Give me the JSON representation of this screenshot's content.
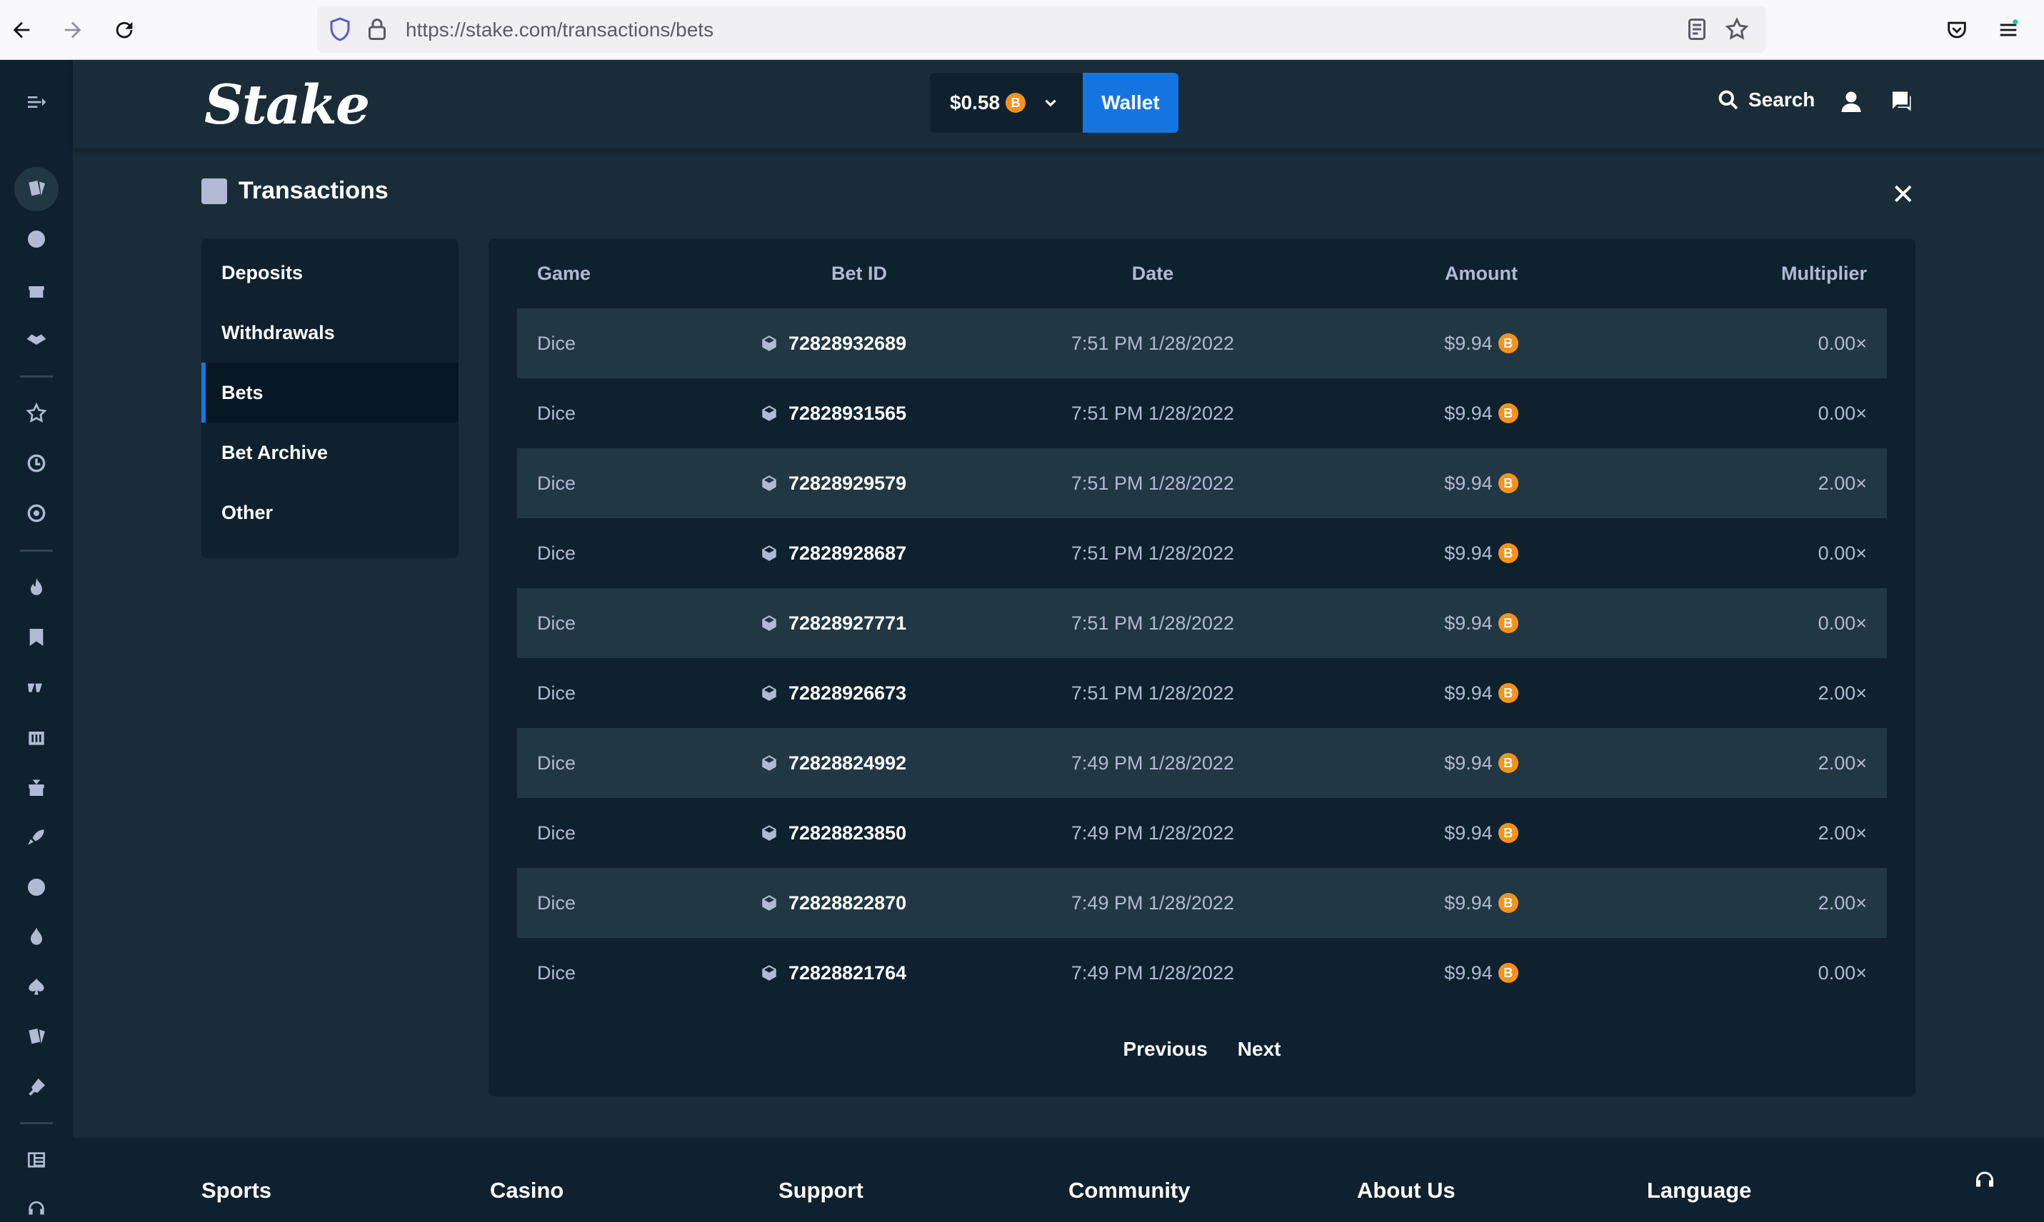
{
  "browser": {
    "url": "https://stake.com/transactions/bets"
  },
  "header": {
    "logo": "Stake",
    "balance": "$0.58",
    "coin_symbol": "B",
    "wallet_label": "Wallet",
    "search_label": "Search"
  },
  "page": {
    "title": "Transactions",
    "close_label": "✕"
  },
  "menu": {
    "items": [
      "Deposits",
      "Withdrawals",
      "Bets",
      "Bet Archive",
      "Other"
    ],
    "active": "Bets"
  },
  "table": {
    "headers": {
      "game": "Game",
      "bet_id": "Bet ID",
      "date": "Date",
      "amount": "Amount",
      "multiplier": "Multiplier"
    },
    "rows": [
      {
        "game": "Dice",
        "bet_id": "72828932689",
        "date": "7:51 PM 1/28/2022",
        "amount": "$9.94",
        "multiplier": "0.00×"
      },
      {
        "game": "Dice",
        "bet_id": "72828931565",
        "date": "7:51 PM 1/28/2022",
        "amount": "$9.94",
        "multiplier": "0.00×"
      },
      {
        "game": "Dice",
        "bet_id": "72828929579",
        "date": "7:51 PM 1/28/2022",
        "amount": "$9.94",
        "multiplier": "2.00×"
      },
      {
        "game": "Dice",
        "bet_id": "72828928687",
        "date": "7:51 PM 1/28/2022",
        "amount": "$9.94",
        "multiplier": "0.00×"
      },
      {
        "game": "Dice",
        "bet_id": "72828927771",
        "date": "7:51 PM 1/28/2022",
        "amount": "$9.94",
        "multiplier": "0.00×"
      },
      {
        "game": "Dice",
        "bet_id": "72828926673",
        "date": "7:51 PM 1/28/2022",
        "amount": "$9.94",
        "multiplier": "2.00×"
      },
      {
        "game": "Dice",
        "bet_id": "72828824992",
        "date": "7:49 PM 1/28/2022",
        "amount": "$9.94",
        "multiplier": "2.00×"
      },
      {
        "game": "Dice",
        "bet_id": "72828823850",
        "date": "7:49 PM 1/28/2022",
        "amount": "$9.94",
        "multiplier": "2.00×"
      },
      {
        "game": "Dice",
        "bet_id": "72828822870",
        "date": "7:49 PM 1/28/2022",
        "amount": "$9.94",
        "multiplier": "2.00×"
      },
      {
        "game": "Dice",
        "bet_id": "72828821764",
        "date": "7:49 PM 1/28/2022",
        "amount": "$9.94",
        "multiplier": "0.00×"
      }
    ]
  },
  "pagination": {
    "previous": "Previous",
    "next": "Next"
  },
  "footer": {
    "columns": [
      "Sports",
      "Casino",
      "Support",
      "Community",
      "About Us",
      "Language"
    ]
  },
  "colors": {
    "background": "#1a2c38",
    "panel": "#0f212e",
    "row_alt": "#213743",
    "accent": "#1475e1",
    "coin": "#f7931a"
  },
  "rail_icons": [
    "menu-toggle-icon",
    "casino-icon",
    "sports-icon",
    "promotions-icon",
    "affiliate-icon",
    "favourites-icon",
    "recent-icon",
    "challenges-icon",
    "hot-icon",
    "bookmark-icon",
    "stake-originals-icon",
    "slots-icon",
    "live-casino-icon",
    "gift-icon",
    "rocket-icon",
    "game-shows-icon",
    "fire-icon",
    "poker-icon",
    "casino-chips-icon",
    "scratch-icon",
    "blog-icon",
    "live-support-icon"
  ]
}
